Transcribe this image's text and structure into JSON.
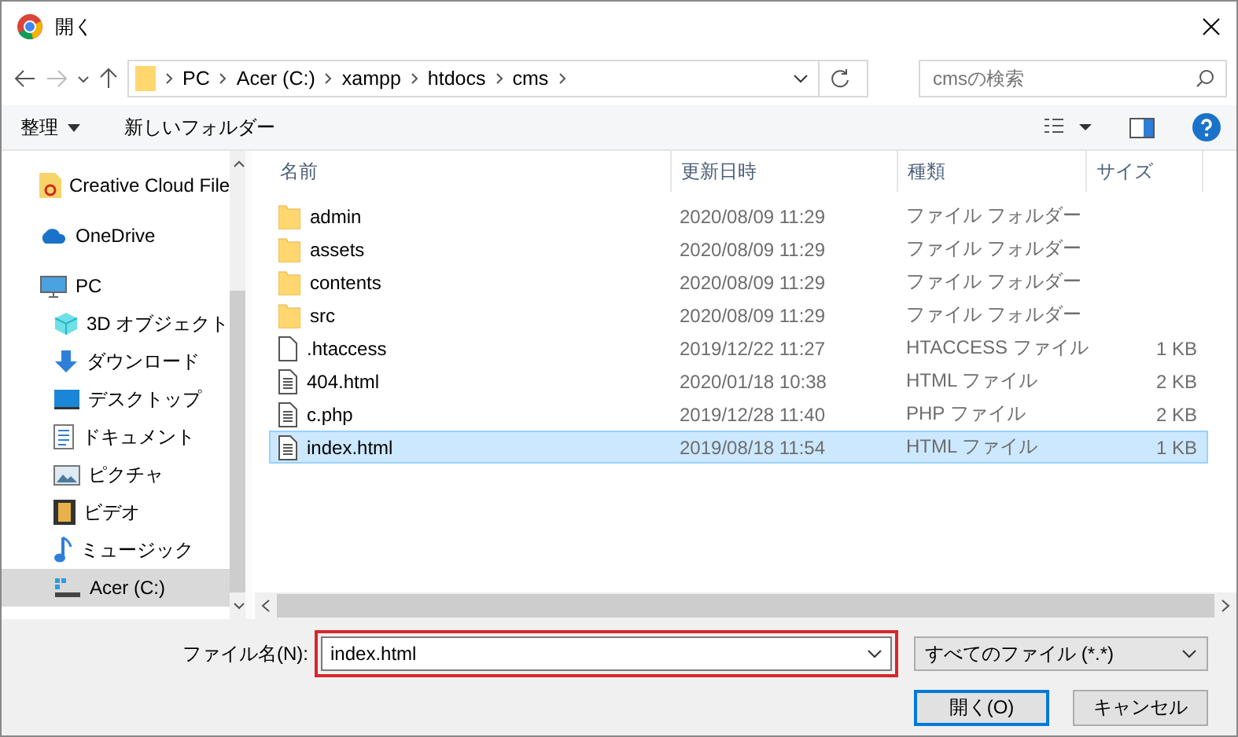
{
  "window": {
    "title": "開く"
  },
  "address": {
    "segments": [
      "PC",
      "Acer (C:)",
      "xampp",
      "htdocs",
      "cms"
    ]
  },
  "search": {
    "placeholder": "cmsの検索"
  },
  "toolbar": {
    "organize": "整理",
    "new_folder": "新しいフォルダー"
  },
  "sidebar": {
    "items": [
      {
        "label": "Creative Cloud File",
        "selected": false
      },
      {
        "label": "OneDrive",
        "selected": false
      },
      {
        "label": "PC",
        "selected": false,
        "children": [
          {
            "label": "3D オブジェクト",
            "selected": false
          },
          {
            "label": "ダウンロード",
            "selected": false
          },
          {
            "label": "デスクトップ",
            "selected": false
          },
          {
            "label": "ドキュメント",
            "selected": false
          },
          {
            "label": "ピクチャ",
            "selected": false
          },
          {
            "label": "ビデオ",
            "selected": false
          },
          {
            "label": "ミュージック",
            "selected": false
          },
          {
            "label": "Acer (C:)",
            "selected": true
          }
        ]
      }
    ]
  },
  "table": {
    "columns": [
      "名前",
      "更新日時",
      "種類",
      "サイズ"
    ],
    "rows": [
      {
        "kind": "folder",
        "name": "admin",
        "date": "2020/08/09 11:29",
        "type": "ファイル フォルダー",
        "selected": false
      },
      {
        "kind": "folder",
        "name": "assets",
        "date": "2020/08/09 11:29",
        "type": "ファイル フォルダー",
        "selected": false
      },
      {
        "kind": "folder",
        "name": "contents",
        "date": "2020/08/09 11:29",
        "type": "ファイル フォルダー",
        "selected": false
      },
      {
        "kind": "folder",
        "name": "src",
        "date": "2020/08/09 11:29",
        "type": "ファイル フォルダー",
        "selected": false
      },
      {
        "kind": "blank",
        "name": ".htaccess",
        "date": "2019/12/22 11:27",
        "type": "HTACCESS ファイル",
        "size": "1 KB",
        "selected": false
      },
      {
        "kind": "doc",
        "name": "404.html",
        "date": "2020/01/18 10:38",
        "type": "HTML ファイル",
        "size": "2 KB",
        "selected": false
      },
      {
        "kind": "doc",
        "name": "c.php",
        "date": "2019/12/28 11:40",
        "type": "PHP ファイル",
        "size": "2 KB",
        "selected": false
      },
      {
        "kind": "doc",
        "name": "index.html",
        "date": "2019/08/18 11:54",
        "type": "HTML ファイル",
        "size": "1 KB",
        "selected": true
      }
    ]
  },
  "filename": {
    "label": "ファイル名(N):",
    "value": "index.html",
    "highlighted": true
  },
  "filter": {
    "value": "すべてのファイル (*.*)"
  },
  "buttons": [
    "開く(O)",
    "キャンセル"
  ]
}
